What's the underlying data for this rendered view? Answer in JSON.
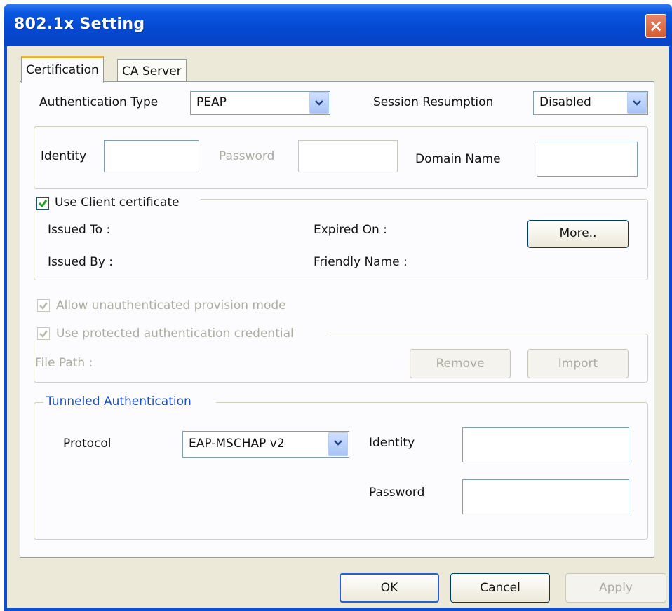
{
  "window": {
    "title": "802.1x Setting",
    "close_glyph": "×"
  },
  "tabs": [
    {
      "label": "Certification",
      "active": true
    },
    {
      "label": "CA Server",
      "active": false
    }
  ],
  "auth": {
    "type_label": "Authentication Type",
    "type_value": "PEAP",
    "session_label": "Session Resumption",
    "session_value": "Disabled"
  },
  "credentials": {
    "identity_label": "Identity",
    "identity_value": "",
    "password_label": "Password",
    "password_value": "",
    "domain_label": "Domain Name",
    "domain_value": ""
  },
  "client_cert": {
    "checkbox_label": "Use Client certificate",
    "checked": true,
    "issued_to_label": "Issued To :",
    "issued_by_label": "Issued By :",
    "expired_on_label": "Expired On :",
    "friendly_name_label": "Friendly Name :",
    "more_button": "More.."
  },
  "provision": {
    "allow_label": "Allow unauthenticated provision mode",
    "use_protected_label": "Use protected authentication credential",
    "file_path_label": "File Path :",
    "remove_button": "Remove",
    "import_button": "Import"
  },
  "tunneled": {
    "group_label": "Tunneled Authentication",
    "protocol_label": "Protocol",
    "protocol_value": "EAP-MSCHAP v2",
    "identity_label": "Identity",
    "identity_value": "",
    "password_label": "Password",
    "password_value": ""
  },
  "footer": {
    "ok_button": "OK",
    "cancel_button": "Cancel",
    "apply_button": "Apply"
  },
  "icons": {
    "dropdown": "chevron-down-icon",
    "checkmark": "checkmark-icon",
    "close": "close-icon"
  },
  "colors": {
    "titlebar": "#0548d0",
    "dialog_bg": "#ece9d8",
    "group_label_blue": "#1c4fc0",
    "disabled_text": "#acaca0"
  }
}
